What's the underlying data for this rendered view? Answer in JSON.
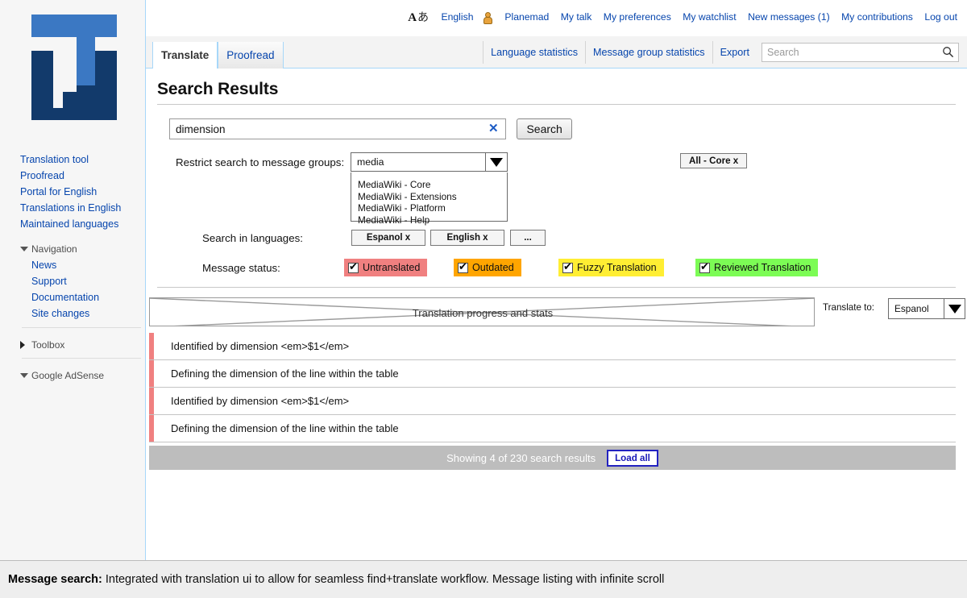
{
  "personal_bar": {
    "lang_icon": "language-icon",
    "language": "English",
    "user_icon": "user-icon",
    "items": [
      {
        "label": "Planemad"
      },
      {
        "label": "My talk"
      },
      {
        "label": "My preferences"
      },
      {
        "label": "My watchlist"
      },
      {
        "label": "New messages (1)"
      },
      {
        "label": "My contributions"
      },
      {
        "label": "Log out"
      }
    ]
  },
  "tabs": {
    "left": [
      {
        "label": "Translate",
        "selected": true
      },
      {
        "label": "Proofread",
        "selected": false
      }
    ],
    "right": [
      {
        "label": "Language statistics"
      },
      {
        "label": "Message group statistics"
      },
      {
        "label": "Export"
      }
    ],
    "search_placeholder": "Search",
    "search_value": "",
    "search_icon": "search-icon"
  },
  "sidebar": {
    "logo_alt": "translatewiki-logo",
    "links": [
      {
        "label": "Translation tool"
      },
      {
        "label": "Proofread"
      },
      {
        "label": "Portal for English"
      },
      {
        "label": "Translations in English"
      },
      {
        "label": "Maintained languages"
      }
    ],
    "portlets": [
      {
        "title": "Navigation",
        "expanded": true,
        "items": [
          {
            "label": "News"
          },
          {
            "label": "Support"
          },
          {
            "label": "Documentation"
          },
          {
            "label": "Site changes"
          }
        ]
      },
      {
        "title": "Toolbox",
        "expanded": false,
        "items": []
      },
      {
        "title": "Google AdSense",
        "expanded": true,
        "items": []
      }
    ]
  },
  "main": {
    "page_title": "Search Results",
    "search": {
      "value": "dimension",
      "placeholder": "",
      "clear_icon": "clear-icon",
      "button_label": "Search"
    },
    "group_filter": {
      "label": "Restrict search to message groups:",
      "input_value": "media",
      "caret_icon": "chevron-down-icon",
      "suggestions": [
        "MediaWiki - Core",
        "MediaWiki - Extensions",
        "MediaWiki - Platform",
        "MediaWiki - Help"
      ],
      "selected_group_chip": "All - Core x"
    },
    "languages": {
      "label": "Search in languages:",
      "chips": [
        {
          "label": "Espanol x"
        },
        {
          "label": "English x"
        },
        {
          "label": "..."
        }
      ]
    },
    "message_status": {
      "label": "Message status:",
      "options": [
        {
          "label": "Untranslated",
          "checked": true,
          "color": "#f08080"
        },
        {
          "label": "Outdated",
          "checked": true,
          "color": "#ffa500"
        },
        {
          "label": "Fuzzy Translation",
          "checked": true,
          "color": "#ffee33"
        },
        {
          "label": "Reviewed Translation",
          "checked": true,
          "color": "#7cfc55"
        }
      ]
    },
    "progress": {
      "placeholder_label": "Translation progress and stats",
      "translate_to_label": "Translate to:",
      "target_language": "Espanol",
      "caret_icon": "chevron-down-icon"
    },
    "results": [
      {
        "text": "Identified by dimension <em>$1</em>",
        "status_color": "#f08080"
      },
      {
        "text": "Defining the dimension of the line within the table",
        "status_color": "#f08080"
      },
      {
        "text": "Identified by dimension <em>$1</em>",
        "status_color": "#f08080"
      },
      {
        "text": "Defining the dimension of the line within the table",
        "status_color": "#f08080"
      }
    ],
    "results_footer": {
      "count_text": "Showing 4 of 230 search results",
      "load_all_label": "Load all"
    }
  },
  "caption": {
    "bold": "Message search:",
    "text": "Integrated with translation ui to allow for seamless find+translate workflow. Message listing with infinite scroll"
  },
  "colors": {
    "link": "#0645ad",
    "tab_border": "#a7d7f9",
    "logo_light": "#3b78c3",
    "logo_dark": "#123a6b"
  }
}
